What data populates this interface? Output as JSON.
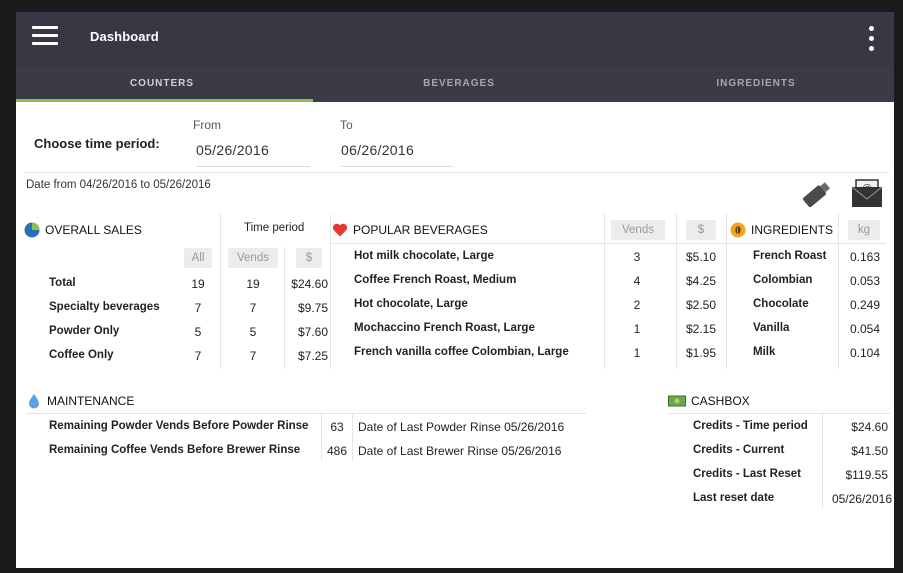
{
  "appbar": {
    "title": "Dashboard"
  },
  "tabs": [
    "COUNTERS",
    "BEVERAGES",
    "INGREDIENTS"
  ],
  "time_period": {
    "label": "Choose time period:",
    "from_label": "From",
    "from_value": "05/26/2016",
    "to_label": "To",
    "to_value": "06/26/2016",
    "range_text": "Date from 04/26/2016 to 05/26/2016"
  },
  "overall_sales": {
    "title": "OVERALL SALES",
    "time_period_header": "Time period",
    "col_all": "All",
    "col_vends": "Vends",
    "col_dollar": "$",
    "rows": [
      {
        "label": "Total",
        "all": "19",
        "vends": "19",
        "amount": "$24.60"
      },
      {
        "label": "Specialty beverages",
        "all": "7",
        "vends": "7",
        "amount": "$9.75"
      },
      {
        "label": "Powder Only",
        "all": "5",
        "vends": "5",
        "amount": "$7.60"
      },
      {
        "label": "Coffee Only",
        "all": "7",
        "vends": "7",
        "amount": "$7.25"
      }
    ]
  },
  "popular_beverages": {
    "title": "POPULAR BEVERAGES",
    "col_vends": "Vends",
    "col_dollar": "$",
    "rows": [
      {
        "name": "Hot milk chocolate, Large",
        "vends": "3",
        "amount": "$5.10"
      },
      {
        "name": "Coffee French Roast, Medium",
        "vends": "4",
        "amount": "$4.25"
      },
      {
        "name": "Hot chocolate, Large",
        "vends": "2",
        "amount": "$2.50"
      },
      {
        "name": "Mochaccino French Roast, Large",
        "vends": "1",
        "amount": "$2.15"
      },
      {
        "name": "French vanilla coffee Colombian, Large",
        "vends": "1",
        "amount": "$1.95"
      }
    ]
  },
  "ingredients": {
    "title": "INGREDIENTS",
    "col_kg": "kg",
    "rows": [
      {
        "name": "French Roast",
        "kg": "0.163"
      },
      {
        "name": "Colombian",
        "kg": "0.053"
      },
      {
        "name": "Chocolate",
        "kg": "0.249"
      },
      {
        "name": "Vanilla",
        "kg": "0.054"
      },
      {
        "name": "Milk",
        "kg": "0.104"
      }
    ]
  },
  "maintenance": {
    "title": "MAINTENANCE",
    "rows": [
      {
        "label": "Remaining Powder Vends Before Powder Rinse",
        "value": "63",
        "date_text": "Date of Last Powder Rinse 05/26/2016"
      },
      {
        "label": "Remaining Coffee Vends Before Brewer Rinse",
        "value": "486",
        "date_text": "Date of Last Brewer Rinse 05/26/2016"
      }
    ]
  },
  "cashbox": {
    "title": "CASHBOX",
    "rows": [
      {
        "label": "Credits - Time period",
        "value": "$24.60"
      },
      {
        "label": "Credits - Current",
        "value": "$41.50"
      },
      {
        "label": "Credits - Last Reset",
        "value": "$119.55"
      },
      {
        "label": "Last reset date",
        "value": "05/26/2016"
      }
    ]
  },
  "colors": {
    "appbar": "#3a3744",
    "tab_indicator": "#8bc34a",
    "pie_blue": "#2a6eb6",
    "heart_red": "#e53935",
    "ingredient_orange": "#f2a51a",
    "drop_blue": "#5aa2e0",
    "cash_green": "#6ea84a"
  }
}
